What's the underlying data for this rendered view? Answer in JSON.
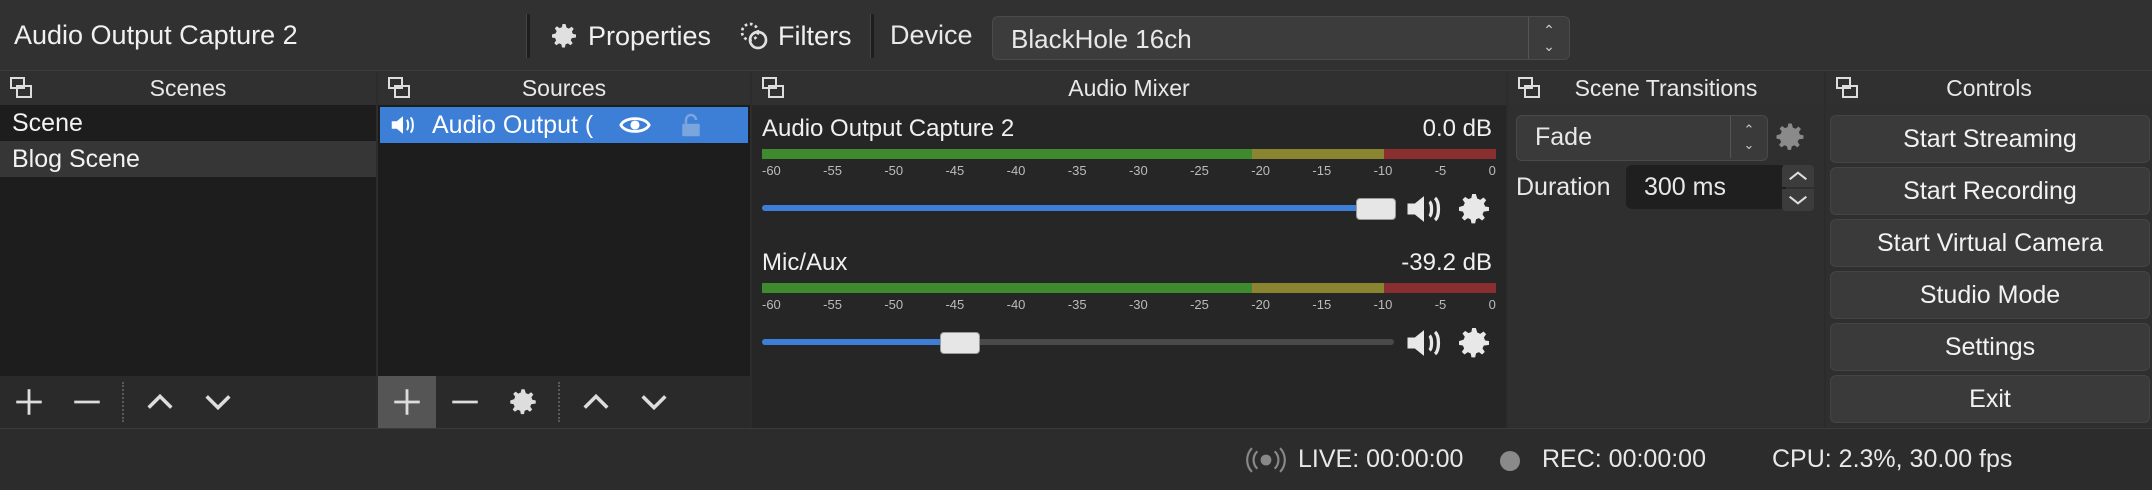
{
  "toolbar": {
    "source_name": "Audio Output Capture 2",
    "properties_label": "Properties",
    "filters_label": "Filters",
    "device_label": "Device",
    "device_value": "BlackHole 16ch"
  },
  "scenes": {
    "title": "Scenes",
    "items": [
      {
        "label": "Scene"
      },
      {
        "label": "Blog Scene"
      }
    ]
  },
  "sources": {
    "title": "Sources",
    "items": [
      {
        "label": "Audio Output (",
        "icon": "speaker-icon"
      }
    ]
  },
  "mixer": {
    "title": "Audio Mixer",
    "channels": [
      {
        "name": "Audio Output Capture 2",
        "db": "0.0 dB",
        "volume": 1.0
      },
      {
        "name": "Mic/Aux",
        "db": "-39.2 dB",
        "volume": 0.3
      }
    ],
    "ticks": [
      "-60",
      "-55",
      "-50",
      "-45",
      "-40",
      "-35",
      "-30",
      "-25",
      "-20",
      "-15",
      "-10",
      "-5",
      "0"
    ]
  },
  "transitions": {
    "title": "Scene Transitions",
    "selected": "Fade",
    "duration_label": "Duration",
    "duration_value": "300 ms"
  },
  "controls": {
    "title": "Controls",
    "buttons": [
      "Start Streaming",
      "Start Recording",
      "Start Virtual Camera",
      "Studio Mode",
      "Settings",
      "Exit"
    ]
  },
  "status": {
    "live": "LIVE: 00:00:00",
    "rec": "REC: 00:00:00",
    "cpu": "CPU: 2.3%, 30.00 fps"
  },
  "colors": {
    "accent": "#3d7fd6",
    "meter_green": "#3f8a2f",
    "meter_yellow": "#8a8530",
    "meter_red": "#8a2f2f"
  }
}
